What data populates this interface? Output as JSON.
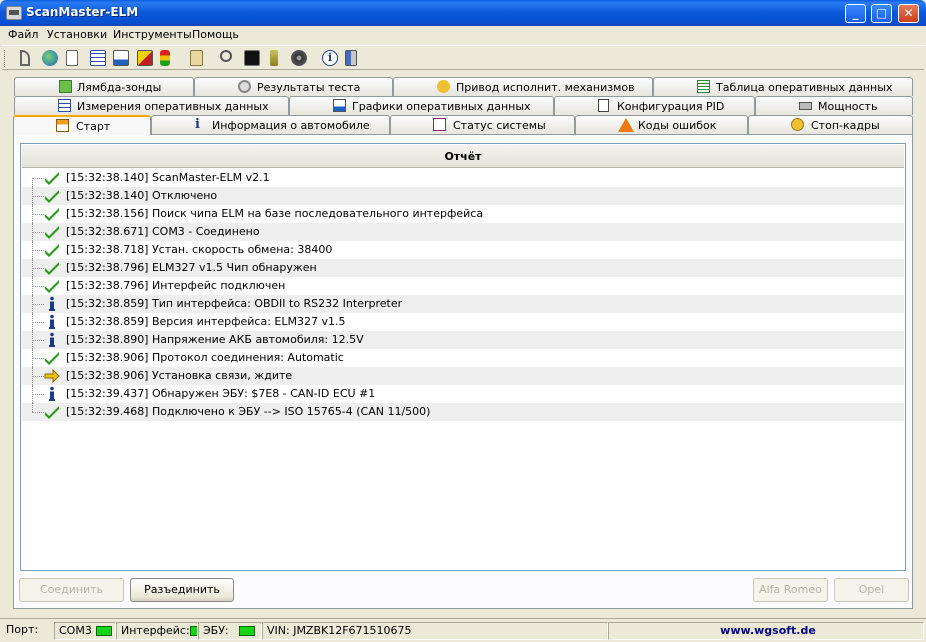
{
  "window": {
    "title": "ScanMaster-ELM"
  },
  "menu": [
    "Файл",
    "Установки",
    "Инструменты",
    "Помощь"
  ],
  "toolbar_icons": [
    "connect-icon",
    "globe-icon",
    "document-icon",
    "grid-icon",
    "chart-icon",
    "trend-icon",
    "traffic-light-icon",
    "clipboard-icon",
    "search-icon",
    "terminal-icon",
    "battery-icon",
    "disc-icon",
    "info-icon",
    "exit-icon"
  ],
  "tabs": {
    "row1": [
      {
        "label": "Лямбда-зонды",
        "icon": "lambda-icon"
      },
      {
        "label": "Результаты теста",
        "icon": "gear-icon"
      },
      {
        "label": "Привод исполнит. механизмов",
        "icon": "actuator-icon"
      },
      {
        "label": "Таблица оперативных данных",
        "icon": "table-icon"
      }
    ],
    "row2": [
      {
        "label": "Измерения оперативных данных",
        "icon": "grid-icon"
      },
      {
        "label": "Графики оперативных данных",
        "icon": "chart-icon"
      },
      {
        "label": "Конфигурация PID",
        "icon": "config-icon"
      },
      {
        "label": "Мощность",
        "icon": "power-icon"
      }
    ],
    "row3": [
      {
        "label": "Старт",
        "icon": "home-icon",
        "active": true
      },
      {
        "label": "Информация о автомобиле",
        "icon": "info-icon"
      },
      {
        "label": "Статус системы",
        "icon": "status-icon"
      },
      {
        "label": "Коды ошибок",
        "icon": "warning-icon"
      },
      {
        "label": "Стоп-кадры",
        "icon": "freeze-icon"
      }
    ]
  },
  "report": {
    "header": "Отчёт",
    "entries": [
      {
        "icon": "check-icon",
        "text": "[15:32:38.140] ScanMaster-ELM v2.1"
      },
      {
        "icon": "check-icon",
        "text": "[15:32:38.140] Отключено"
      },
      {
        "icon": "check-icon",
        "text": "[15:32:38.156] Поиск чипа ELM на базе последовательного интерфейса"
      },
      {
        "icon": "check-icon",
        "text": "[15:32:38.671] COM3 - Соединено"
      },
      {
        "icon": "check-icon",
        "text": "[15:32:38.718] Устан. скорость обмена: 38400"
      },
      {
        "icon": "check-icon",
        "text": "[15:32:38.796] ELM327 v1.5 Чип обнаружен"
      },
      {
        "icon": "check-icon",
        "text": "[15:32:38.796] Интерфейс подключен"
      },
      {
        "icon": "info-icon",
        "text": "[15:32:38.859] Тип интерфейса: OBDII to RS232 Interpreter"
      },
      {
        "icon": "info-icon",
        "text": "[15:32:38.859] Версия интерфейса: ELM327 v1.5"
      },
      {
        "icon": "info-icon",
        "text": "[15:32:38.890] Напряжение АКБ автомобиля: 12.5V"
      },
      {
        "icon": "check-icon",
        "text": "[15:32:38.906] Протокол соединения: Automatic"
      },
      {
        "icon": "arrow-right-icon",
        "text": "[15:32:38.906] Установка связи, ждите"
      },
      {
        "icon": "info-icon",
        "text": "[15:32:39.437] Обнаружен ЭБУ: $7E8 - CAN-ID ECU #1"
      },
      {
        "icon": "check-icon",
        "text": "[15:32:39.468] Подключено к ЭБУ --> ISO 15765-4 (CAN 11/500)"
      }
    ]
  },
  "buttons": {
    "connect": "Соединить",
    "disconnect": "Разъединить",
    "alfa": "Alfa Romeo",
    "opel": "Opel"
  },
  "status": {
    "port_label": "Порт:",
    "port_value": "COM3",
    "interface_label": "Интерфейс:",
    "ecu_label": "ЭБУ:",
    "vin": "VIN: JMZBK12F671510675",
    "link": "www.wgsoft.de"
  },
  "colors": {
    "led": "#18d418",
    "check": "#2a9a1a",
    "info": "#1c3a8a",
    "arrow": "#f0c000"
  }
}
